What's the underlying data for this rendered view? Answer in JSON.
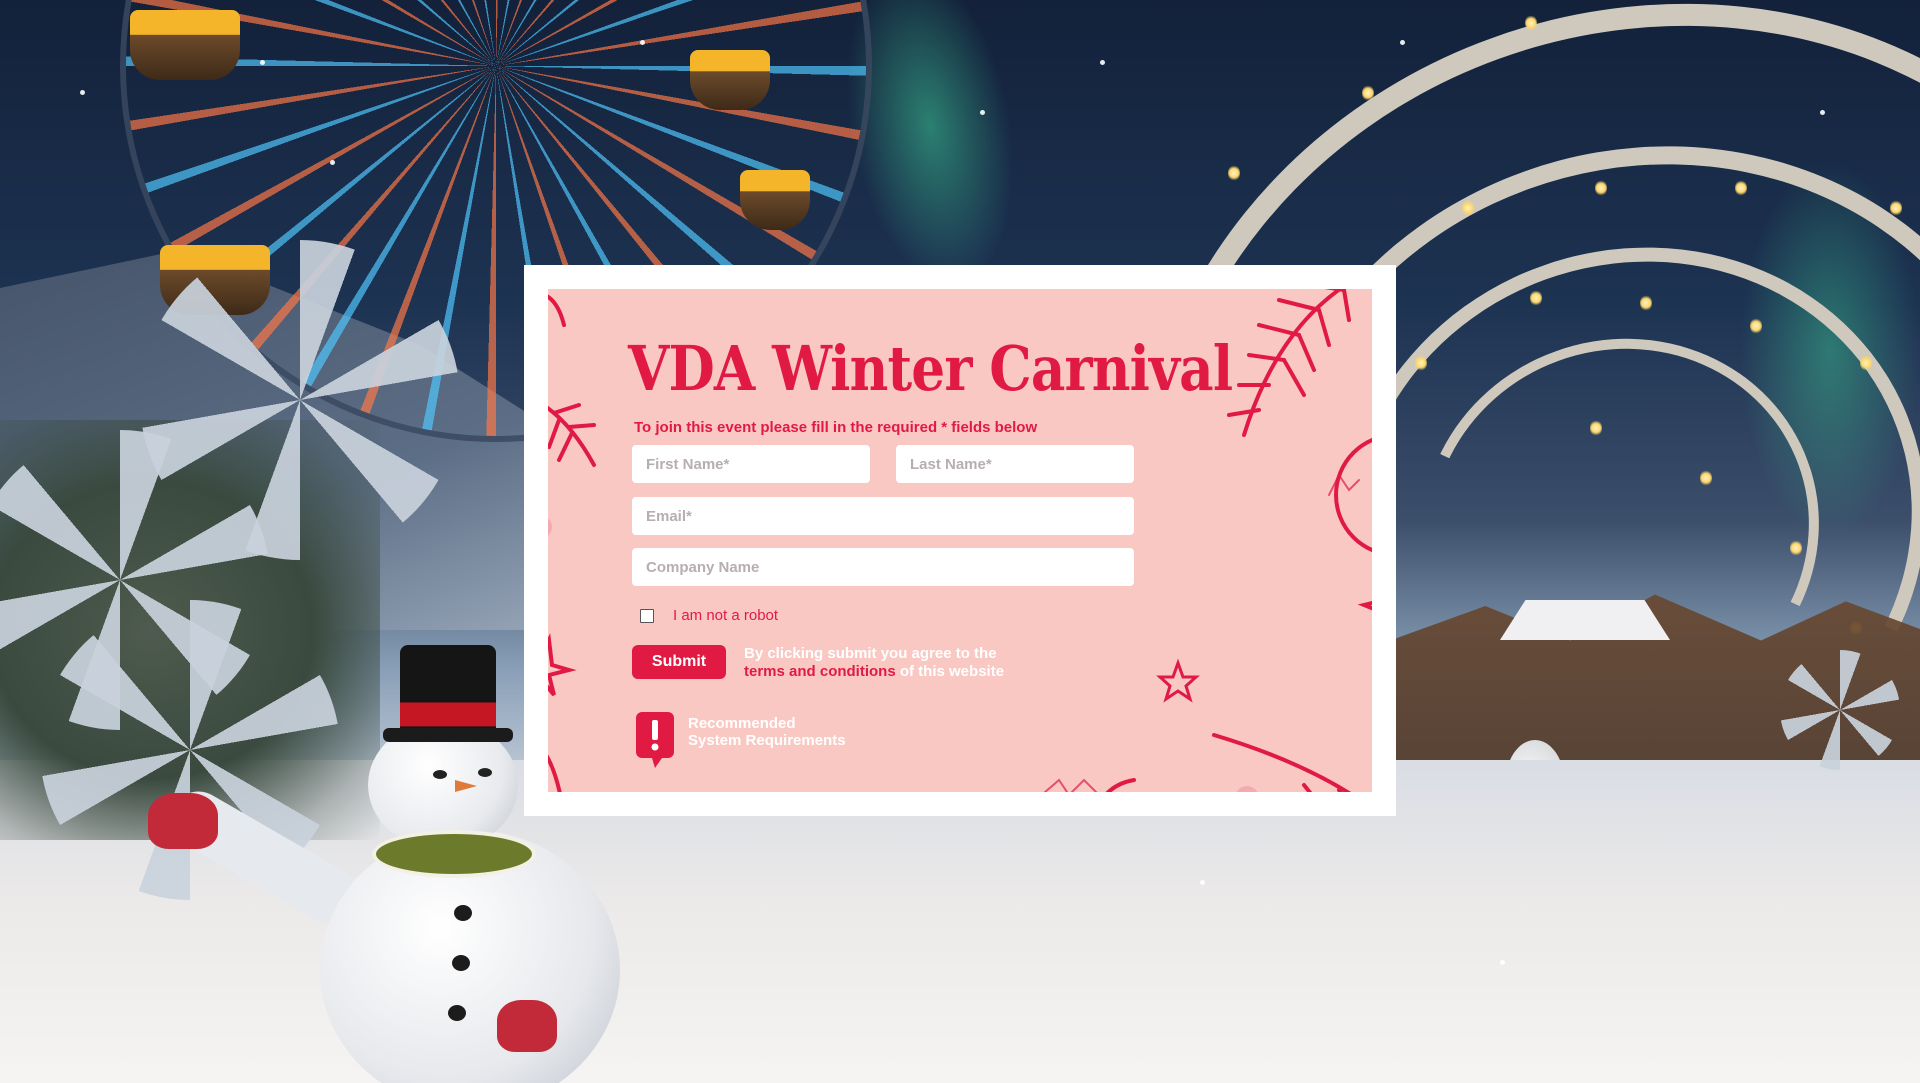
{
  "page": {
    "title": "VDA Winter Carnival",
    "instructions": "To join this event please fill in the required * fields below"
  },
  "form": {
    "first_name_placeholder": "First Name*",
    "last_name_placeholder": "Last Name*",
    "email_placeholder": "Email*",
    "company_placeholder": "Company Name",
    "captcha_label": "I am not a robot",
    "captcha_checked": false,
    "submit_label": "Submit",
    "terms_prefix": "By clicking submit you agree to the",
    "terms_link": "terms and conditions",
    "terms_suffix": " of this website"
  },
  "requirements": {
    "line1": "Recommended",
    "line2": "System Requirements",
    "icon": "exclamation-bubble-icon"
  },
  "colors": {
    "accent": "#e11a44",
    "card_background": "#fac8c3",
    "card_border": "#ffffff"
  }
}
